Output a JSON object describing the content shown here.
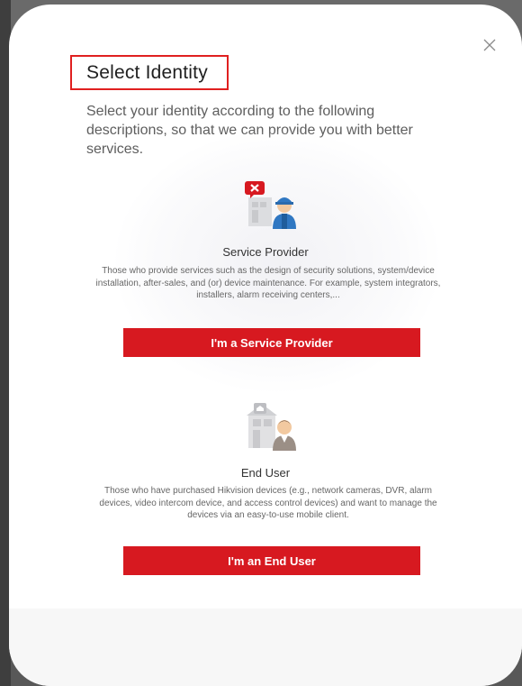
{
  "dialog": {
    "title": "Select Identity",
    "intro": "Select your identity according to the following descriptions, so that we can provide you with better services."
  },
  "roles": [
    {
      "title": "Service Provider",
      "description": "Those who provide services such as the design of security solutions, system/device installation, after-sales, and (or) device maintenance. For example, system integrators, installers, alarm receiving centers,...",
      "button_label": "I'm a Service Provider",
      "icon": "service-provider-icon"
    },
    {
      "title": "End User",
      "description": "Those who have purchased Hikvision devices (e.g., network cameras, DVR, alarm devices, video intercom device, and access control devices) and want to manage the devices via an easy-to-use mobile client.",
      "button_label": "I'm an End User",
      "icon": "end-user-icon"
    }
  ],
  "close_icon": "close-icon",
  "colors": {
    "accent": "#d71920",
    "title_highlight": "#e02020"
  }
}
